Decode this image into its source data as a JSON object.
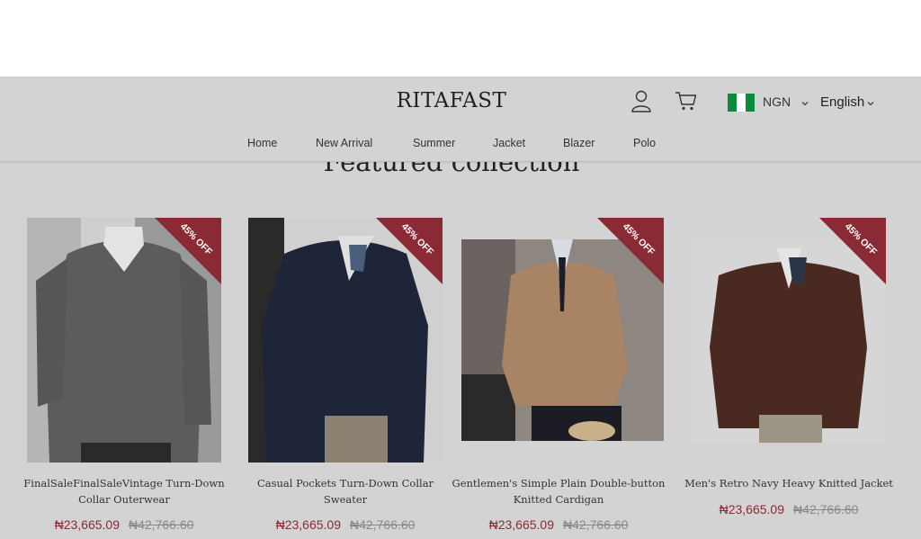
{
  "header": {
    "logo": "RITAFAST",
    "currency": "NGN",
    "language": "English",
    "flag_colors": [
      "#0a8a3a",
      "#ffffff",
      "#0a8a3a"
    ]
  },
  "nav": {
    "items": [
      {
        "label": "Home"
      },
      {
        "label": "New Arrival"
      },
      {
        "label": "Summer"
      },
      {
        "label": "Jacket"
      },
      {
        "label": "Blazer"
      },
      {
        "label": "Polo"
      }
    ]
  },
  "section": {
    "title": "Featured collection"
  },
  "products": [
    {
      "name": "FinalSaleFinalSaleVintage Turn-Down Collar Outerwear",
      "price": "₦23,665.09",
      "old_price": "₦42,766.60",
      "badge": "45% OFF",
      "jacket_color": "#5c5c5c"
    },
    {
      "name": "Casual Pockets Turn-Down Collar Sweater",
      "price": "₦23,665.09",
      "old_price": "₦42,766.60",
      "badge": "45% OFF",
      "jacket_color": "#1e2538"
    },
    {
      "name": "Gentlemen's Simple Plain Double-button Knitted Cardigan",
      "price": "₦23,665.09",
      "old_price": "₦42,766.60",
      "badge": "45% OFF",
      "jacket_color": "#a88364"
    },
    {
      "name": "Men's Retro Navy Heavy Knitted Jacket",
      "price": "₦23,665.09",
      "old_price": "₦42,766.60",
      "badge": "45% OFF",
      "jacket_color": "#4a2a20"
    }
  ],
  "colors": {
    "accent": "#8a2a35",
    "overlay_gray": "#d3d3d3"
  }
}
